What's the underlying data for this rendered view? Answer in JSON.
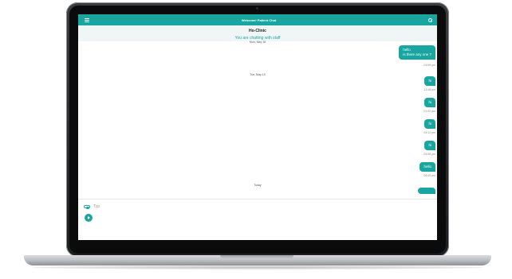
{
  "app": {
    "title": "Welcome! Patient Chat"
  },
  "header": {
    "clinic_name": "Ho-Clinic",
    "status": "You are chatting with staff"
  },
  "messages": {
    "date1": "Mon, May 18",
    "m1_line1": "hello",
    "m1_line2": "is there any one ?",
    "m1_time": "03:59 pm",
    "date2": "Tue, May 19",
    "m2_text": "hi",
    "m2_time": "12:48 pm",
    "m3_text": "hi",
    "m3_time": "01:02 pm",
    "m4_text": "hi",
    "m4_time": "04:12 pm",
    "m5_text": "hi",
    "m5_time": "05:58 pm",
    "m6_text": "hello",
    "m6_time": "06:00 pm",
    "date3": "Today"
  },
  "composer": {
    "placeholder": "Typ"
  },
  "colors": {
    "accent": "#1aa6a0",
    "subheader_bg": "#f0f6f6"
  },
  "icons": {
    "menu": "menu-icon",
    "search": "search-icon",
    "attach": "attach-icon",
    "send": "send-icon"
  }
}
